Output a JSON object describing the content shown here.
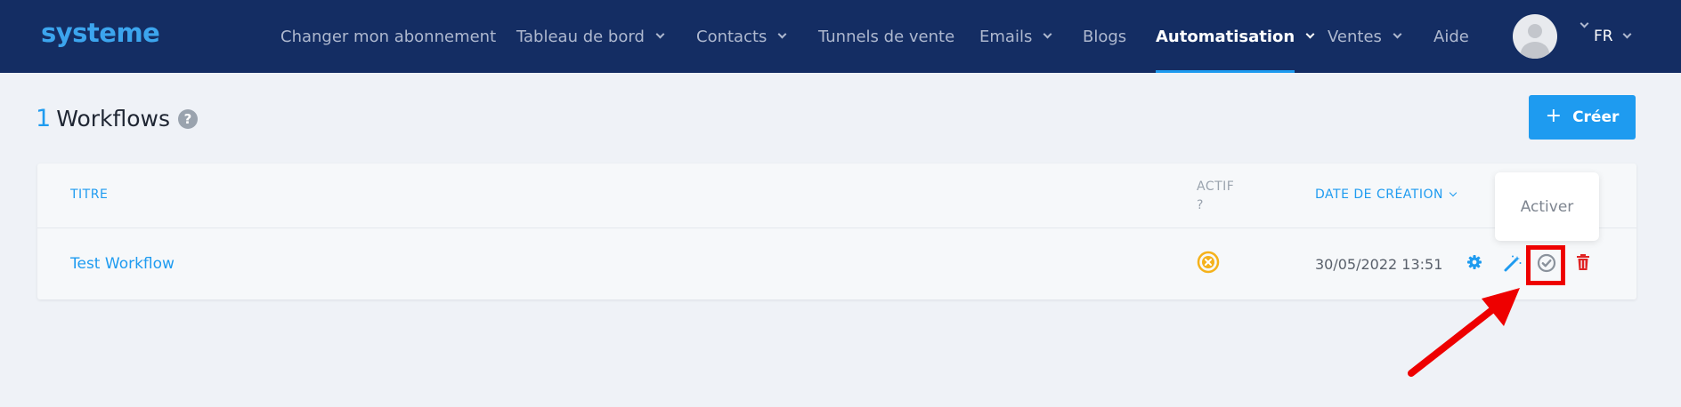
{
  "brand": {
    "logo": "systeme"
  },
  "nav": {
    "items": [
      {
        "label": "Changer mon abonnement"
      },
      {
        "label": "Tableau de bord"
      },
      {
        "label": "Contacts"
      },
      {
        "label": "Tunnels de vente"
      },
      {
        "label": "Emails"
      },
      {
        "label": "Blogs"
      },
      {
        "label": "Automatisation"
      },
      {
        "label": "Ventes"
      },
      {
        "label": "Aide"
      }
    ],
    "active": "Automatisation",
    "language": "FR"
  },
  "page": {
    "count": "1",
    "title": "Workflows",
    "help_icon": "?",
    "create_label": "Créer"
  },
  "table": {
    "headers": {
      "title": "TITRE",
      "active": "ACTIF ?",
      "date": "DATE DE CRÉATION"
    },
    "rows": [
      {
        "title": "Test Workflow",
        "active": false,
        "date": "30/05/2022 13:51"
      }
    ],
    "row_action_icons": [
      "gear-icon",
      "magic-wand-icon",
      "check-circle-icon",
      "trash-icon"
    ]
  },
  "tooltip": {
    "label": "Activer"
  },
  "colors": {
    "navbar": "#142d63",
    "accent": "#1e9bf0",
    "inactive_status": "#f5b21b",
    "delete": "#e02424",
    "annotation": "#ee0000"
  }
}
